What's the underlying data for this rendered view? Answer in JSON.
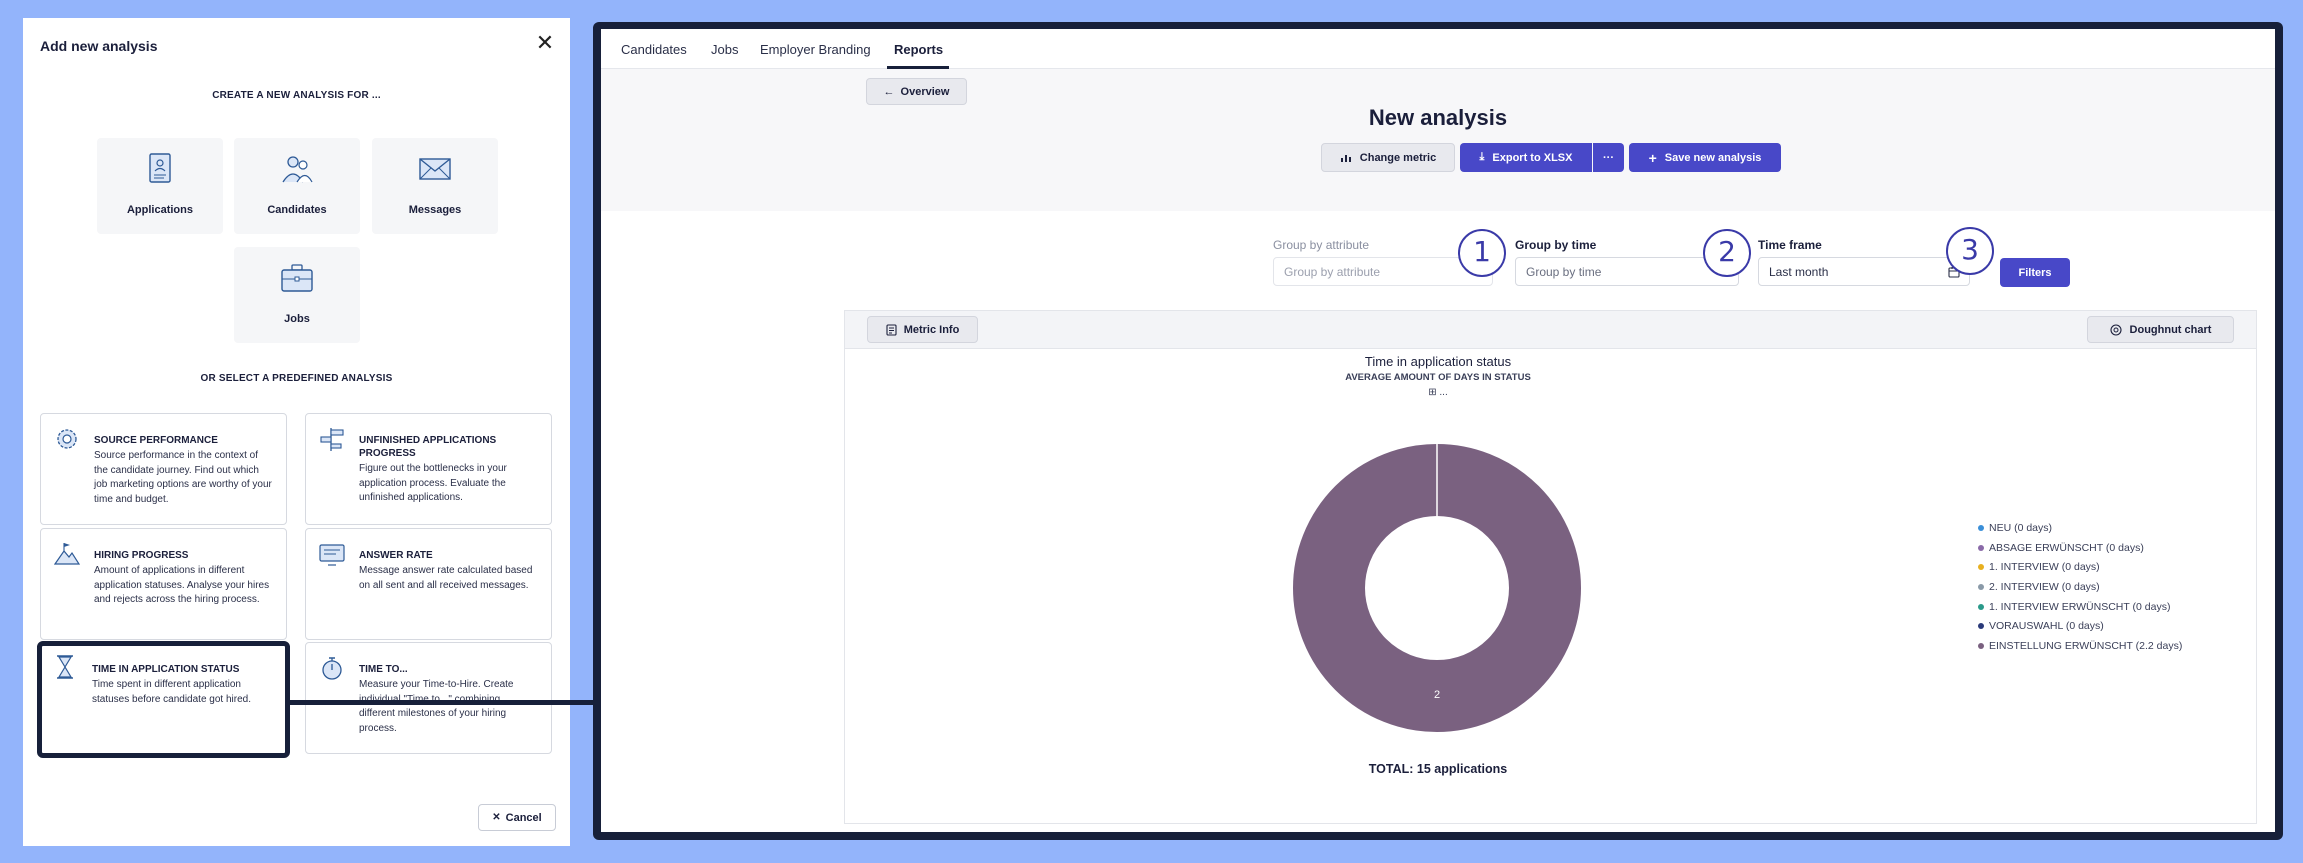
{
  "modal": {
    "title": "Add new analysis",
    "create_heading": "CREATE A NEW ANALYSIS FOR ...",
    "tiles": [
      {
        "label": "Applications",
        "icon": "application-form-icon"
      },
      {
        "label": "Candidates",
        "icon": "candidates-icon"
      },
      {
        "label": "Messages",
        "icon": "envelope-icon"
      },
      {
        "label": "Jobs",
        "icon": "briefcase-icon"
      }
    ],
    "predefined_heading": "OR SELECT A PREDEFINED ANALYSIS",
    "cards": [
      {
        "title": "SOURCE PERFORMANCE",
        "description": "Source performance in the context of the candidate journey. Find out which job marketing options are worthy of your time and budget.",
        "icon": "source-gear-icon"
      },
      {
        "title": "UNFINISHED APPLICATIONS PROGRESS",
        "description": "Figure out the bottlenecks in your application process. Evaluate the unfinished applications.",
        "icon": "signpost-icon"
      },
      {
        "title": "HIRING PROGRESS",
        "description": "Amount of applications in different application statuses. Analyse your hires and rejects across the hiring process.",
        "icon": "mountain-flag-icon"
      },
      {
        "title": "ANSWER RATE",
        "description": "Message answer rate calculated based on all sent and all received messages.",
        "icon": "message-screen-icon"
      },
      {
        "title": "TIME IN APPLICATION STATUS",
        "description": "Time spent in different application statuses before candidate got hired.",
        "icon": "hourglass-icon",
        "selected": true
      },
      {
        "title": "TIME TO...",
        "description": "Measure your Time-to-Hire. Create individual \"Time to...\" combining different milestones of your hiring process.",
        "icon": "stopwatch-icon"
      }
    ],
    "cancel_label": "Cancel"
  },
  "app": {
    "nav_tabs": [
      {
        "label": "Candidates",
        "active": false
      },
      {
        "label": "Jobs",
        "active": false
      },
      {
        "label": "Employer Branding",
        "active": false
      },
      {
        "label": "Reports",
        "active": true
      }
    ],
    "overview_label": "Overview",
    "page_title": "New analysis",
    "change_metric_label": "Change metric",
    "export_label": "Export to XLSX",
    "more_label": "···",
    "save_label": "Save new analysis",
    "controls": {
      "group_attribute": {
        "label": "Group by attribute",
        "placeholder": "Group by attribute"
      },
      "group_time": {
        "label": "Group by time",
        "placeholder": "Group by time"
      },
      "time_frame": {
        "label": "Time frame",
        "value": "Last month"
      },
      "filters_label": "Filters"
    },
    "step_numbers": [
      "1",
      "2",
      "3"
    ],
    "metric_info_label": "Metric Info",
    "chart_type_label": "Doughnut chart",
    "accent_color": "#4848c8"
  },
  "chart_data": {
    "type": "pie",
    "donut": true,
    "title": "Time in application status",
    "subtitle": "AVERAGE AMOUNT OF DAYS IN STATUS",
    "note": "⊞ ...",
    "total_label": "TOTAL: 15 applications",
    "legend_placement": "right",
    "slice_label": "2",
    "series": [
      {
        "name": "NEU (0 days)",
        "value": 0,
        "color": "#3a8fd8"
      },
      {
        "name": "ABSAGE ERWÜNSCHT (0 days)",
        "value": 0,
        "color": "#8a6aa8"
      },
      {
        "name": "1. INTERVIEW (0 days)",
        "value": 0,
        "color": "#e8b020"
      },
      {
        "name": "2. INTERVIEW (0 days)",
        "value": 0,
        "color": "#8a9aa8"
      },
      {
        "name": "1. INTERVIEW ERWÜNSCHT (0 days)",
        "value": 0,
        "color": "#2a9a8a"
      },
      {
        "name": "VORAUSWAHL (0 days)",
        "value": 0,
        "color": "#2a3a7a"
      },
      {
        "name": "EINSTELLUNG ERWÜNSCHT (2.2 days)",
        "value": 2.2,
        "color": "#7a6180"
      }
    ]
  }
}
